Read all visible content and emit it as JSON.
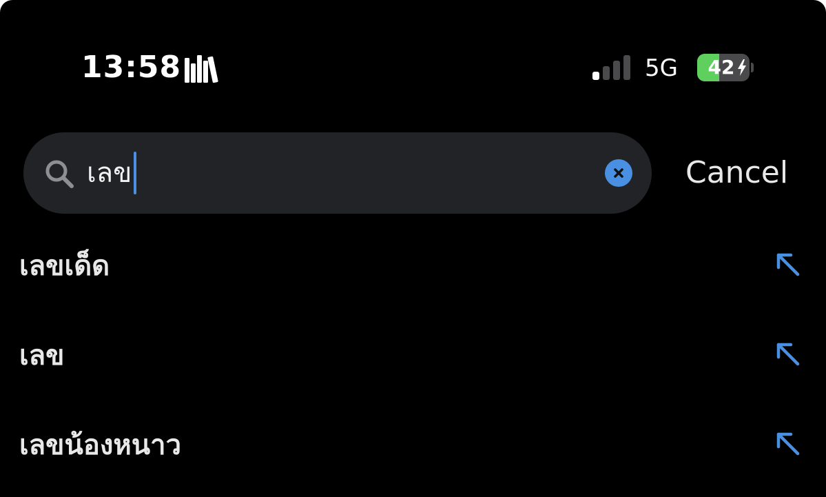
{
  "status_bar": {
    "time": "13:58",
    "network": "5G",
    "battery_level": 42,
    "battery_text": "42",
    "signal_bars_active": 1,
    "icons": [
      "library-icon",
      "signal-icon",
      "battery-icon",
      "charging-bolt-icon"
    ]
  },
  "search": {
    "query": "เลข",
    "cancel_label": "Cancel",
    "icons": [
      "search-icon",
      "clear-icon"
    ]
  },
  "suggestions": [
    {
      "label": "เลขเด็ด",
      "icon": "fill-arrow-icon"
    },
    {
      "label": "เลข",
      "icon": "fill-arrow-icon"
    },
    {
      "label": "เลขน้องหนาว",
      "icon": "fill-arrow-icon"
    }
  ],
  "colors": {
    "background": "#000000",
    "search_field": "#222326",
    "accent": "#4a90e2",
    "battery_green": "#5fcf5d",
    "text": "#e8e8e8"
  }
}
